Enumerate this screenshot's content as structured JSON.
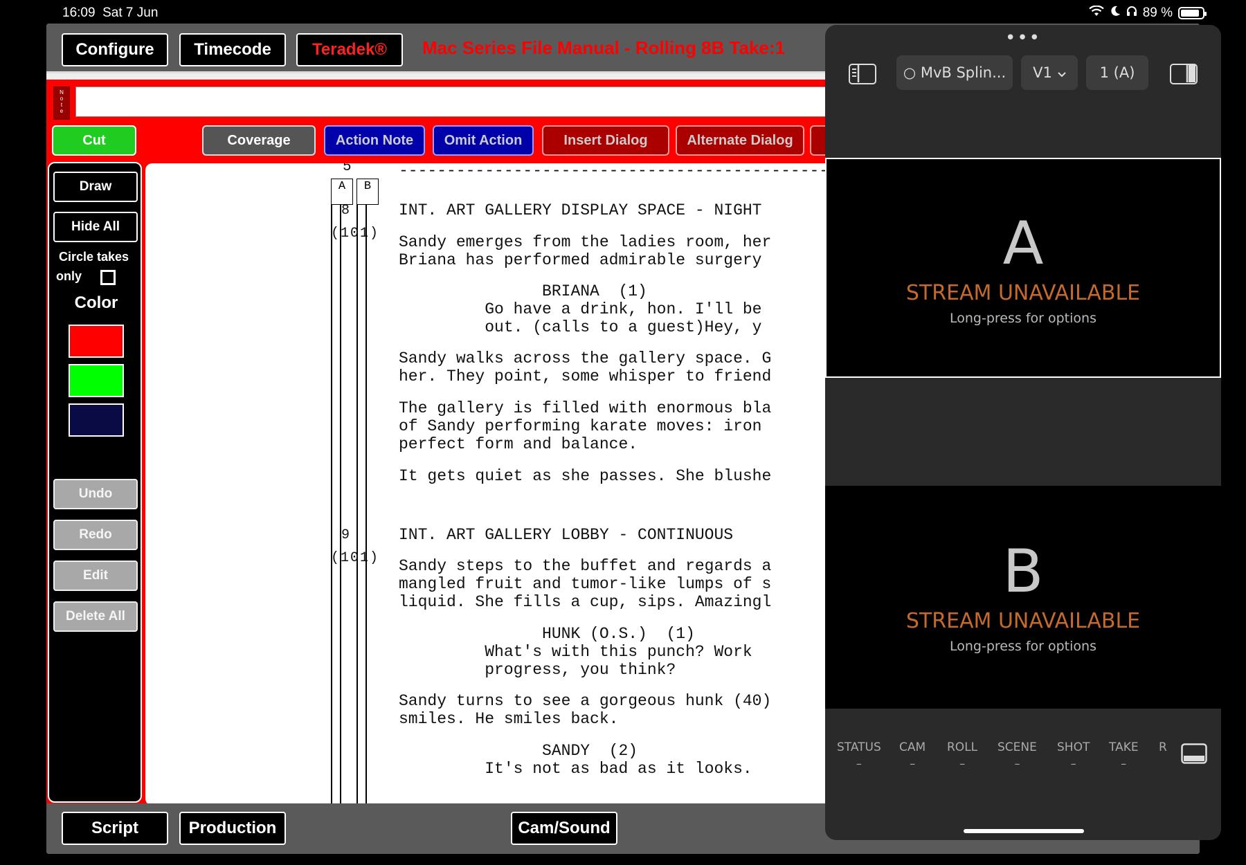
{
  "status_bar": {
    "time": "16:09",
    "date": "Sat 7 Jun",
    "battery": "89 %"
  },
  "top_bar": {
    "configure": "Configure",
    "timecode": "Timecode",
    "teradek": "Teradek®",
    "roll_info": "Mac Series File Manual - Rolling 8B Take:1"
  },
  "note_tab": "Note",
  "action_bar": {
    "cut": "Cut",
    "coverage": "Coverage",
    "action_note": "Action Note",
    "omit_action": "Omit Action",
    "insert_dialog": "Insert Dialog",
    "alternate_dialog": "Alternate Dialog"
  },
  "side_panel": {
    "draw": "Draw",
    "hide_all": "Hide All",
    "circle_takes": "Circle takes",
    "only": "only",
    "color_label": "Color",
    "colors": [
      "#ff0000",
      "#00ff00",
      "#0a0a45"
    ],
    "undo": "Undo",
    "redo": "Redo",
    "edit": "Edit",
    "delete_all": "Delete All"
  },
  "script": {
    "page_number": "5",
    "divider": "-----------------------------------------------------------",
    "cam_a": "A",
    "cam_b": "B",
    "setup1": {
      "shot": "8",
      "code": "(101)"
    },
    "setup2": {
      "shot": "9",
      "code": "(101)"
    },
    "lines": [
      "INT. ART GALLERY DISPLAY SPACE - NIGHT",
      "Sandy emerges from the ladies room, her",
      "Briana has performed admirable surgery",
      "               BRIANA  (1)",
      "         Go have a drink, hon. I'll be",
      "         out. (calls to a guest)Hey, y",
      "Sandy walks across the gallery space. G",
      "her. They point, some whisper to friend",
      "The gallery is filled with enormous bla",
      "of Sandy performing karate moves: iron",
      "perfect form and balance.",
      "It gets quiet as she passes. She blushe",
      "INT. ART GALLERY LOBBY - CONTINUOUS",
      "Sandy steps to the buffet and regards a",
      "mangled fruit and tumor-like lumps of s",
      "liquid. She fills a cup, sips. Amazingl",
      "               HUNK (O.S.)  (1)",
      "         What's with this punch? Work",
      "         progress, you think?",
      "Sandy turns to see a gorgeous hunk (40)",
      "smiles. He smiles back.",
      "               SANDY  (2)",
      "         It's not as bad as it looks."
    ]
  },
  "bottom_bar": {
    "script": "Script",
    "production": "Production",
    "cam_sound": "Cam/Sound"
  },
  "slide_over": {
    "dots": "•••",
    "source": "○ MvB Splin...",
    "version": "V1",
    "angle": "1 (A)",
    "stream_a": {
      "letter": "A",
      "status": "STREAM UNAVAILABLE",
      "hint": "Long-press for options"
    },
    "stream_b": {
      "letter": "B",
      "status": "STREAM UNAVAILABLE",
      "hint": "Long-press for options"
    },
    "footer": [
      {
        "label": "STATUS",
        "value": "–"
      },
      {
        "label": "CAM",
        "value": "–"
      },
      {
        "label": "ROLL",
        "value": "–"
      },
      {
        "label": "SCENE",
        "value": "–"
      },
      {
        "label": "SHOT",
        "value": "–"
      },
      {
        "label": "TAKE",
        "value": "–"
      },
      {
        "label": "R",
        "value": ""
      }
    ],
    "accent": "#c66a2c"
  }
}
